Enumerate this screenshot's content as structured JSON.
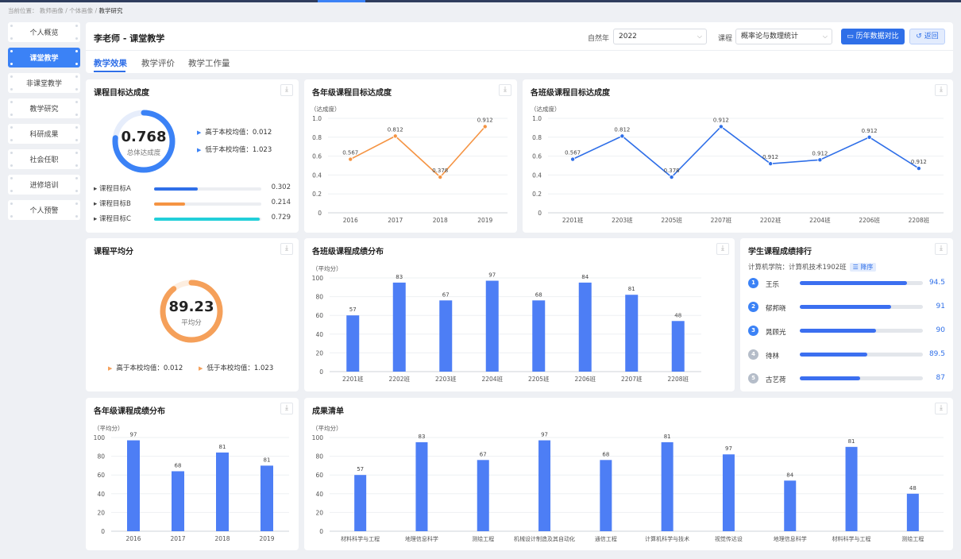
{
  "breadcrumb": {
    "prefix": "当前位置：",
    "path": "教师画像 / 个体画像 / ",
    "current": "教学研究"
  },
  "sidebar": {
    "items": [
      {
        "label": "个人概览",
        "active": false
      },
      {
        "label": "课堂教学",
        "active": true
      },
      {
        "label": "非课堂教学",
        "active": false
      },
      {
        "label": "教学研究",
        "active": false
      },
      {
        "label": "科研成果",
        "active": false
      },
      {
        "label": "社会任职",
        "active": false
      },
      {
        "label": "进修培训",
        "active": false
      },
      {
        "label": "个人预警",
        "active": false
      }
    ]
  },
  "header": {
    "title": "李老师 - 课堂教学",
    "year_label": "自然年",
    "year_value": "2022",
    "course_label": "课程",
    "course_value": "概率论与数理统计",
    "compare_button": "历年数据对比",
    "back_button": "返回",
    "tabs": [
      "教学效果",
      "教学评价",
      "教学工作量"
    ],
    "active_tab": 0
  },
  "goal": {
    "title": "课程目标达成度",
    "ring_value": "0.768",
    "ring_fraction": 0.768,
    "ring_label": "总体达成度",
    "above": "高于本校均值：0.012",
    "below": "低于本校均值：1.023",
    "bars": [
      {
        "label": "课程目标A",
        "value": "0.302",
        "fraction": 0.302,
        "color": "#2f6fe8"
      },
      {
        "label": "课程目标B",
        "value": "0.214",
        "fraction": 0.214,
        "color": "#f59443"
      },
      {
        "label": "课程目标C",
        "value": "0.729",
        "fraction": 0.729,
        "color": "#22cfd9"
      }
    ]
  },
  "avg": {
    "title": "课程平均分",
    "ring_value": "89.23",
    "ring_fraction": 0.8923,
    "ring_label": "平均分",
    "above": "高于本校均值：0.012",
    "below": "低于本校均值：1.023"
  },
  "ranking": {
    "title": "学生课程成绩排行",
    "subtitle": "计算机学院：计算机技术1902班",
    "sort_label": "降序",
    "rows": [
      {
        "rank": "1",
        "name": "王乐",
        "value": "94.5",
        "fraction": 0.87,
        "color": "#3b82f6"
      },
      {
        "rank": "2",
        "name": "郁邦晓",
        "value": "91",
        "fraction": 0.74,
        "color": "#3b82f6"
      },
      {
        "rank": "3",
        "name": "晁顾光",
        "value": "90",
        "fraction": 0.62,
        "color": "#3b82f6"
      },
      {
        "rank": "4",
        "name": "待林",
        "value": "89.5",
        "fraction": 0.55,
        "color": "#b5bdc9"
      },
      {
        "rank": "5",
        "name": "古艺荷",
        "value": "87",
        "fraction": 0.49,
        "color": "#b5bdc9"
      }
    ]
  },
  "colors": {
    "accent": "#2f6fe8",
    "orange": "#f59443",
    "bar": "#4d7ef5"
  },
  "chart_data": [
    {
      "id": "grade_goal",
      "type": "line",
      "title": "各年级课程目标达成度",
      "ylabel": "（达成度）",
      "categories": [
        "2016",
        "2017",
        "2018",
        "2019"
      ],
      "values": [
        0.567,
        0.812,
        0.378,
        0.912
      ],
      "labels": [
        "0.567",
        "0.812",
        "0.378",
        "0.912"
      ],
      "ylim": [
        0,
        1.0
      ],
      "yticks": [
        "0",
        "0.2",
        "0.4",
        "0.6",
        "0.8",
        "1.0"
      ],
      "color": "#f59443"
    },
    {
      "id": "class_goal",
      "type": "line",
      "title": "各班级课程目标达成度",
      "ylabel": "（达成度）",
      "categories": [
        "2201班",
        "2203班",
        "2205班",
        "2207班",
        "2202班",
        "2204班",
        "2206班",
        "2208班"
      ],
      "values": [
        0.567,
        0.812,
        0.378,
        0.912,
        0.912,
        0.912,
        0.912,
        0.912
      ],
      "labels": [
        "0.567",
        "0.812",
        "0.378",
        "0.912",
        "0.912",
        "0.912",
        "0.912",
        "0.912"
      ],
      "plot_values": [
        0.567,
        0.812,
        0.378,
        0.912,
        0.52,
        0.56,
        0.8,
        0.47
      ],
      "ylim": [
        0,
        1.0
      ],
      "yticks": [
        "0",
        "0.2",
        "0.4",
        "0.6",
        "0.8",
        "1.0"
      ],
      "color": "#2f6fe8"
    },
    {
      "id": "class_score",
      "type": "bar",
      "title": "各班级课程成绩分布",
      "ylabel": "（平均分）",
      "categories": [
        "2201班",
        "2202班",
        "2203班",
        "2204班",
        "2205班",
        "2206班",
        "2207班",
        "2208班"
      ],
      "values": [
        57,
        83,
        67,
        97,
        68,
        84,
        81,
        48
      ],
      "plot_values": [
        60,
        95,
        76,
        97,
        76,
        95,
        82,
        54
      ],
      "ylim": [
        0,
        100
      ],
      "yticks": [
        "0",
        "20",
        "40",
        "60",
        "80",
        "100"
      ],
      "color": "#4d7ef5"
    },
    {
      "id": "grade_score",
      "type": "bar",
      "title": "各年级课程成绩分布",
      "ylabel": "（平均分）",
      "categories": [
        "2016",
        "2017",
        "2018",
        "2019"
      ],
      "values": [
        97,
        68,
        81,
        81
      ],
      "plot_values": [
        97,
        64,
        84,
        70
      ],
      "ylim": [
        0,
        100
      ],
      "yticks": [
        "0",
        "20",
        "40",
        "60",
        "80",
        "100"
      ],
      "color": "#4d7ef5"
    },
    {
      "id": "achievements",
      "type": "bar",
      "title": "成果清单",
      "ylabel": "（平均分）",
      "categories": [
        "材料科学与工程",
        "地理信息科学",
        "测绘工程",
        "机械设计制造及其自动化",
        "通信工程",
        "计算机科学与技术",
        "视觉传达设",
        "地理信息科学",
        "材料科学与工程",
        "测绘工程"
      ],
      "values": [
        57,
        83,
        67,
        97,
        68,
        81,
        97,
        84,
        81,
        48
      ],
      "plot_values": [
        60,
        95,
        76,
        97,
        76,
        95,
        82,
        54,
        90,
        40
      ],
      "ylim": [
        0,
        100
      ],
      "yticks": [
        "0",
        "20",
        "40",
        "60",
        "80",
        "100"
      ],
      "color": "#4d7ef5"
    }
  ]
}
